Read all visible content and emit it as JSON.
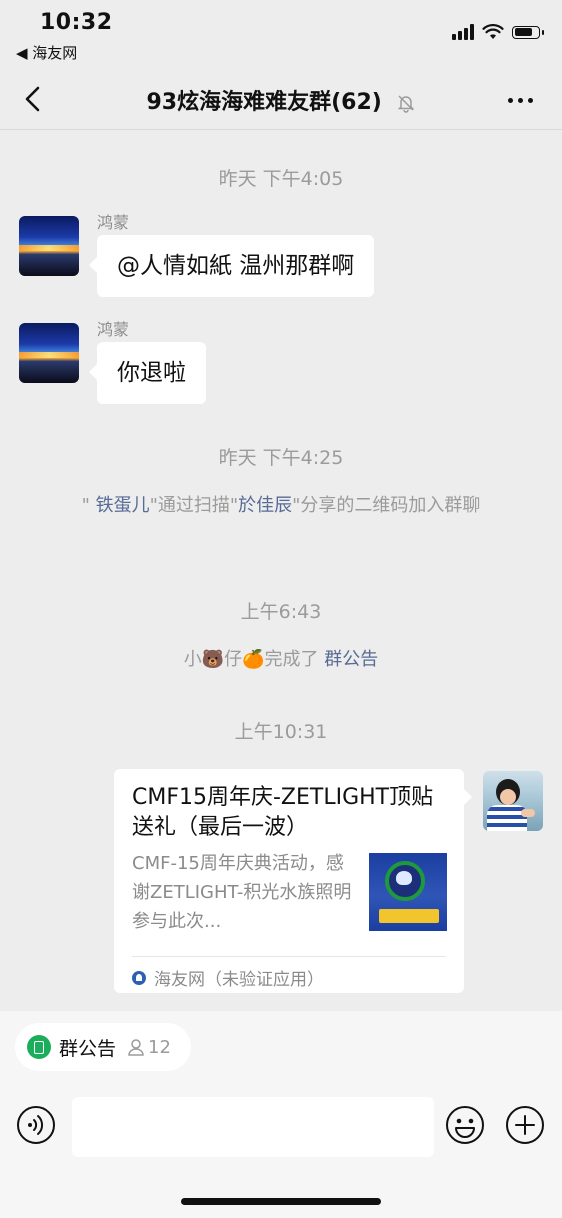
{
  "status_bar": {
    "time": "10:32",
    "back_app": "◀ 海友网"
  },
  "nav": {
    "title": "93炫海海难难友群(62)",
    "back_icon": "chevron-left-icon",
    "more_icon": "ellipsis-icon",
    "mute_icon": "bell-off-icon"
  },
  "messages": {
    "ts1": "昨天 下午4:05",
    "msg1": {
      "sender": "鸿蒙",
      "text": "@人情如紙 温州那群啊"
    },
    "msg2": {
      "sender": "鸿蒙",
      "text": "你退啦"
    },
    "ts2": "昨天 下午4:25",
    "sys1": {
      "q1": "\"",
      "user1": "铁蛋儿",
      "mid": "\"通过扫描\"",
      "user2": "於佳辰",
      "end": "\"分享的二维码加入群聊"
    },
    "ts3": "上午6:43",
    "sys2": {
      "prefix": "小🐻仔🍊完成了",
      "link": "群公告"
    },
    "ts4": "上午10:31",
    "card": {
      "title": "CMF15周年庆-ZETLIGHT顶贴送礼（最后一波）",
      "desc": "CMF-15周年庆典活动，感谢ZETLIGHT-积光水族照明参与此次...",
      "source": "海友网（未验证应用）"
    }
  },
  "bottom": {
    "notice_label": "群公告",
    "notice_count": "12",
    "input_value": "",
    "icons": [
      "voice-icon",
      "emoji-icon",
      "plus-icon"
    ]
  },
  "colors": {
    "link": "#576b95",
    "notice_green": "#1aad5b",
    "bg": "#ededed"
  }
}
